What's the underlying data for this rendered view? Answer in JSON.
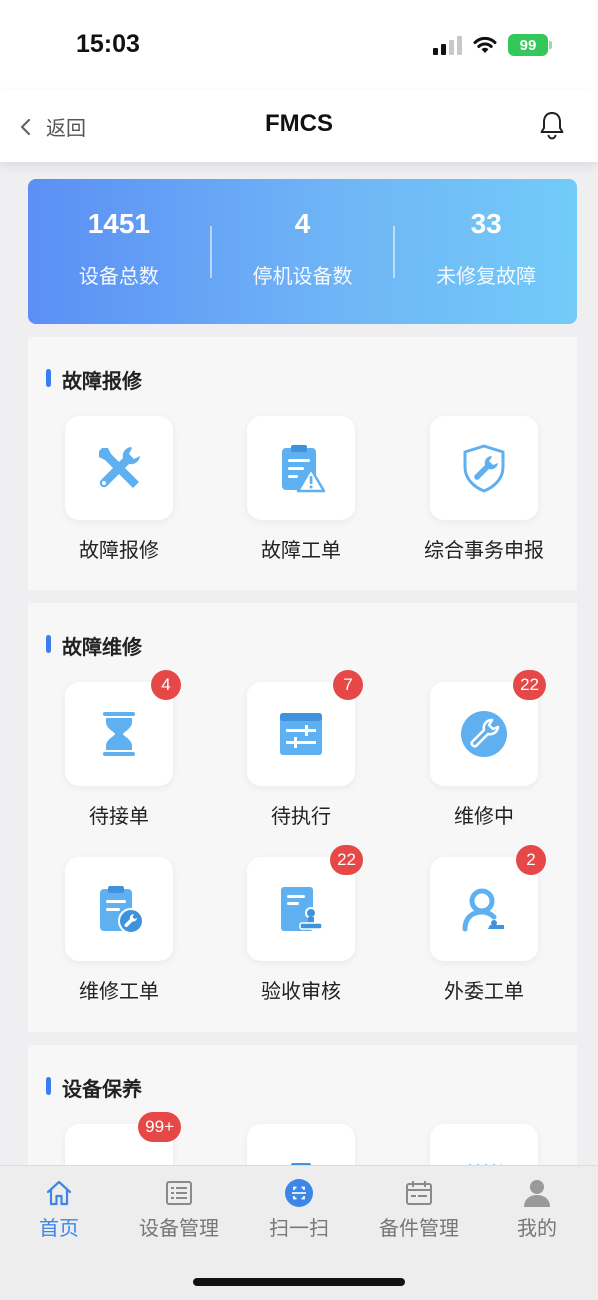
{
  "status_bar": {
    "time": "15:03",
    "battery": "99"
  },
  "nav": {
    "back_label": "返回",
    "title": "FMCS"
  },
  "stats": [
    {
      "value": "1451",
      "label": "设备总数"
    },
    {
      "value": "4",
      "label": "停机设备数"
    },
    {
      "value": "33",
      "label": "未修复故障"
    }
  ],
  "sections": {
    "fault_report": {
      "title": "故障报修",
      "items": [
        {
          "label": "故障报修",
          "icon": "tools-icon"
        },
        {
          "label": "故障工单",
          "icon": "warning-clipboard-icon"
        },
        {
          "label": "综合事务申报",
          "icon": "shield-wrench-icon"
        }
      ]
    },
    "fault_repair": {
      "title": "故障维修",
      "items": [
        {
          "label": "待接单",
          "badge": "4",
          "icon": "hourglass-icon"
        },
        {
          "label": "待执行",
          "badge": "7",
          "icon": "sliders-icon"
        },
        {
          "label": "维修中",
          "badge": "22",
          "icon": "wrench-circle-icon"
        },
        {
          "label": "维修工单",
          "badge": "",
          "icon": "clipboard-gear-icon"
        },
        {
          "label": "验收审核",
          "badge": "22",
          "icon": "stamp-document-icon"
        },
        {
          "label": "外委工单",
          "badge": "2",
          "icon": "person-icon"
        }
      ]
    },
    "maintenance": {
      "title": "设备保养",
      "items": [
        {
          "label": "",
          "badge": "99+",
          "icon": "oil-can-icon"
        },
        {
          "label": "",
          "badge": "",
          "icon": "clipboard-icon"
        },
        {
          "label": "",
          "badge": "",
          "icon": "calendar-icon"
        }
      ]
    }
  },
  "tabbar": [
    {
      "label": "首页",
      "icon": "home-icon",
      "active": true
    },
    {
      "label": "设备管理",
      "icon": "list-icon",
      "active": false
    },
    {
      "label": "扫一扫",
      "icon": "scan-icon",
      "active": false
    },
    {
      "label": "备件管理",
      "icon": "calendar-icon",
      "active": false
    },
    {
      "label": "我的",
      "icon": "user-icon",
      "active": false
    }
  ],
  "colors": {
    "accent": "#3d86e8",
    "icon_blue": "#5fb0f0",
    "badge": "#e64848",
    "battery": "#34c759"
  }
}
